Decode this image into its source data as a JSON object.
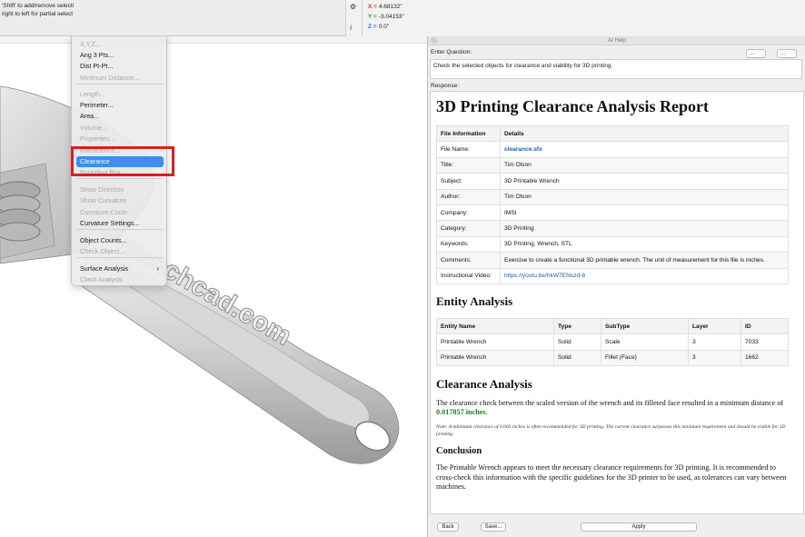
{
  "hint": {
    "line1": "'Shift' to add/remove selecti",
    "line2": " right to left for partial select"
  },
  "coords": {
    "x_label": "X =",
    "x_value": "4.68132\"",
    "y_label": "Y =",
    "y_value": "-3.04153\"",
    "z_label": "Z =",
    "z_value": "0.0\"",
    "icon1": "⚙",
    "icon2": "i"
  },
  "canvas": {
    "watermark": "punchcad.com"
  },
  "menu": {
    "items": [
      {
        "label": "X,Y,Z...",
        "disabled": true
      },
      {
        "label": "Ang 3 Pts...",
        "disabled": false
      },
      {
        "label": "Dist Pt-Pt...",
        "disabled": false
      },
      {
        "label": "Minimum Distance...",
        "disabled": true
      },
      {
        "label": "Length...",
        "disabled": true
      },
      {
        "label": "Perimeter...",
        "disabled": false
      },
      {
        "label": "Area...",
        "disabled": false
      },
      {
        "label": "Volume...",
        "disabled": true
      },
      {
        "label": "Properties...",
        "disabled": true
      },
      {
        "label": "Interference...",
        "disabled": true
      },
      {
        "label": "Clearance",
        "disabled": false,
        "selected": true
      },
      {
        "label": "Bounding Box...",
        "disabled": true
      },
      {
        "label": "Show Direction",
        "disabled": true
      },
      {
        "label": "Show Curvature",
        "disabled": true
      },
      {
        "label": "Curvature Circle",
        "disabled": true
      },
      {
        "label": "Curvature Settings...",
        "disabled": false
      },
      {
        "label": "Object Counts...",
        "disabled": false
      },
      {
        "label": "Check Object...",
        "disabled": true
      },
      {
        "label": "Surface Analysis",
        "disabled": false,
        "submenu": true
      },
      {
        "label": "Clash Analysis",
        "disabled": true
      }
    ],
    "submenu_chevron": "›"
  },
  "ai_help": {
    "title": "AI Help",
    "question_label": "Enter Question:",
    "question_text": "Check the selected objects for clearance and viability for 3D printing.",
    "select1": "...",
    "select2": "...",
    "response_label": "Response:",
    "report": {
      "title": "3D Printing Clearance Analysis Report",
      "file_info_headers": [
        "File Information",
        "Details"
      ],
      "file_info_rows": [
        {
          "k": "File Name:",
          "v": "clearance.sfx",
          "style": "link-bold"
        },
        {
          "k": "Title:",
          "v": "Tim Olson"
        },
        {
          "k": "Subject:",
          "v": "3D Printable Wrench"
        },
        {
          "k": "Author:",
          "v": "Tim Olson"
        },
        {
          "k": "Company:",
          "v": "IMSI"
        },
        {
          "k": "Category:",
          "v": "3D Printing"
        },
        {
          "k": "Keywords:",
          "v": "3D Printing, Wrench, STL"
        },
        {
          "k": "Comments:",
          "v": "Exercise to create a functional 3D printable wrench. The unit of measurement for this file is inches."
        },
        {
          "k": "Instructional Video:",
          "v": "https://youtu.be/hkW7ENszd-8",
          "style": "link"
        }
      ],
      "entity_heading": "Entity Analysis",
      "entity_headers": [
        "Entity Name",
        "Type",
        "SubType",
        "Layer",
        "ID"
      ],
      "entity_rows": [
        [
          "Printable Wrench",
          "Solid",
          "Scale",
          "3",
          "7033"
        ],
        [
          "Printable Wrench",
          "Solid",
          "Fillet (Face)",
          "3",
          "1662"
        ]
      ],
      "clearance_heading": "Clearance Analysis",
      "clearance_text": "The clearance check between the scaled version of the wrench and its filleted face resulted in a minimum distance of ",
      "clearance_value": "0.017857 inches",
      "clearance_end": ".",
      "note": "Note: A minimum clearance of 0.005 inches is often recommended for 3D printing. The current clearance surpasses this minimum requirement and should be visible for 3D printing.",
      "conclusion_heading": "Conclusion",
      "conclusion_text": "The Printable Wrench appears to meet the necessary clearance requirements for 3D printing. It is recommended to cross-check this information with the specific guidelines for the 3D printer to be used, as tolerances can vary between machines."
    },
    "buttons": {
      "back": "Back",
      "save": "Save...",
      "apply": "Apply"
    }
  },
  "colors": {
    "selection": "#3d8ef0",
    "highlight_box": "#d62020",
    "link": "#1a5fb4",
    "value_green": "#1f7a1f"
  }
}
